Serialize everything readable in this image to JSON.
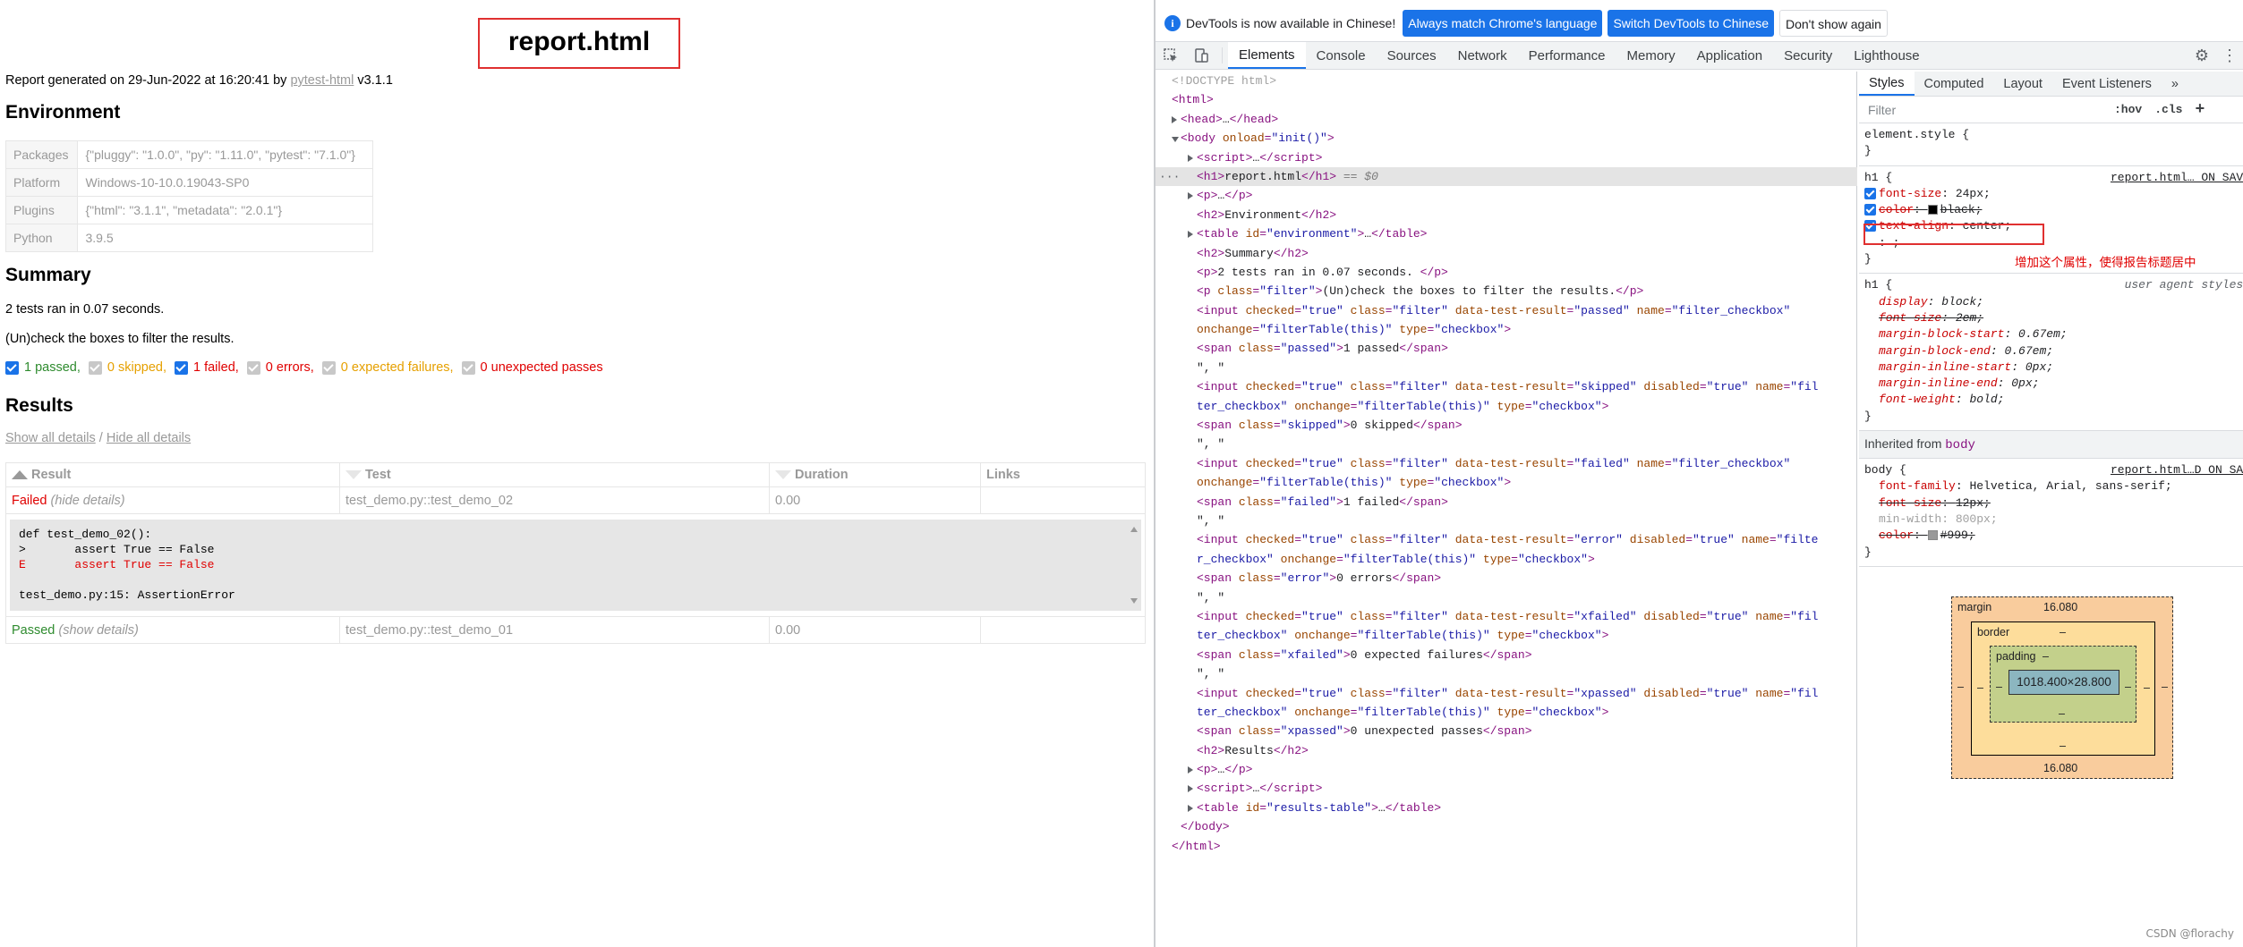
{
  "report": {
    "title": "report.html",
    "generated_prefix": "Report generated on 29-Jun-2022 at 16:20:41 by ",
    "generated_link": "pytest-html",
    "generated_suffix": " v3.1.1",
    "env_heading": "Environment",
    "environment": [
      {
        "key": "Packages",
        "value": "{\"pluggy\": \"1.0.0\", \"py\": \"1.11.0\", \"pytest\": \"7.1.0\"}"
      },
      {
        "key": "Platform",
        "value": "Windows-10-10.0.19043-SP0"
      },
      {
        "key": "Plugins",
        "value": "{\"html\": \"3.1.1\", \"metadata\": \"2.0.1\"}"
      },
      {
        "key": "Python",
        "value": "3.9.5"
      }
    ],
    "summary_heading": "Summary",
    "summary_text": "2 tests ran in 0.07 seconds.",
    "filter_hint": "(Un)check the boxes to filter the results.",
    "filters": [
      {
        "label": "1 passed",
        "checked": true,
        "disabled": false
      },
      {
        "label": "0 skipped",
        "checked": true,
        "disabled": true
      },
      {
        "label": "1 failed",
        "checked": true,
        "disabled": false
      },
      {
        "label": "0 errors",
        "checked": true,
        "disabled": true
      },
      {
        "label": "0 expected failures",
        "checked": true,
        "disabled": true
      },
      {
        "label": "0 unexpected passes",
        "checked": true,
        "disabled": true
      }
    ],
    "results_heading": "Results",
    "show_all": "Show all details",
    "hide_all": "Hide all details",
    "slash": " / ",
    "columns": [
      "Result",
      "Test",
      "Duration",
      "Links"
    ],
    "rows": [
      {
        "result": "Failed",
        "toggle": "(hide details)",
        "test": "test_demo.py::test_demo_02",
        "duration": "0.00",
        "links": ""
      },
      {
        "result": "Passed",
        "toggle": "(show details)",
        "test": "test_demo.py::test_demo_01",
        "duration": "0.00",
        "links": ""
      }
    ],
    "log_lines": [
      "def test_demo_02():",
      ">       assert True == False",
      "E       assert True == False",
      "",
      "test_demo.py:15: AssertionError"
    ]
  },
  "devtools": {
    "info_text": "DevTools is now available in Chinese!",
    "btn_match": "Always match Chrome's language",
    "btn_switch": "Switch DevTools to Chinese",
    "btn_dont": "Don't show again",
    "tabs": [
      "Elements",
      "Console",
      "Sources",
      "Network",
      "Performance",
      "Memory",
      "Application",
      "Security",
      "Lighthouse"
    ],
    "style_tabs": [
      "Styles",
      "Computed",
      "Layout",
      "Event Listeners"
    ],
    "more_tabs": "»",
    "filter_placeholder": "Filter",
    "hov": ":hov",
    "cls": ".cls",
    "plus": "+",
    "element_style": "element.style {",
    "close_brace": "}",
    "h1_rule": {
      "selector": "h1 {",
      "source": "report.html…_ON_SAVE",
      "props": [
        {
          "name": "font-size",
          "value": "24px;"
        },
        {
          "name": "color",
          "value": "black;"
        },
        {
          "name": "text-align",
          "value": "center;"
        }
      ],
      "partial": ": ;"
    },
    "annotation": "增加这个属性，使得报告标题居中",
    "ua_rule": {
      "selector": "h1 {",
      "source": "user agent stylesh",
      "props": [
        {
          "name": "display",
          "value": "block;",
          "struck": false
        },
        {
          "name": "font-size",
          "value": "2em;",
          "struck": true
        },
        {
          "name": "margin-block-start",
          "value": "0.67em;",
          "struck": false
        },
        {
          "name": "margin-block-end",
          "value": "0.67em;",
          "struck": false
        },
        {
          "name": "margin-inline-start",
          "value": "0px;",
          "struck": false
        },
        {
          "name": "margin-inline-end",
          "value": "0px;",
          "struck": false
        },
        {
          "name": "font-weight",
          "value": "bold;",
          "struck": false
        }
      ]
    },
    "inherited_label": "Inherited from ",
    "inherited_tag": "body",
    "body_rule": {
      "selector": "body {",
      "source": "report.html…D_ON_SAV",
      "props": [
        {
          "name": "font-family",
          "value": "Helvetica, Arial, sans-serif;",
          "struck": false,
          "dim": false
        },
        {
          "name": "font-size",
          "value": "12px;",
          "struck": true,
          "dim": false
        },
        {
          "name": "min-width",
          "value": "800px;",
          "struck": false,
          "dim": true
        },
        {
          "name": "color",
          "value": "#999;",
          "struck": true,
          "dim": false
        }
      ]
    },
    "box_model": {
      "margin_label": "margin",
      "margin_top": "16.080",
      "margin_bottom": "16.080",
      "border_label": "border",
      "border_val": "–",
      "padding_label": "padding",
      "padding_val": "–",
      "content": "1018.400×28.800",
      "dash": "–"
    },
    "dom_lines": [
      {
        "indent": 0,
        "tw": "",
        "html": "<span class='cm'>&lt;!DOCTYPE html&gt;</span>"
      },
      {
        "indent": 0,
        "tw": "",
        "html": "<span class='tag'>&lt;html&gt;</span>"
      },
      {
        "indent": 1,
        "tw": "c",
        "html": "<span class='tag'>&lt;head&gt;</span><span class='tx'>…</span><span class='tag'>&lt;/head&gt;</span>"
      },
      {
        "indent": 1,
        "tw": "o",
        "html": "<span class='tag'>&lt;body </span><span class='an'>onload</span><span class='tag'>=</span><span class='av'>\"init()\"</span><span class='tag'>&gt;</span>"
      },
      {
        "indent": 2,
        "tw": "c",
        "html": "<span class='tag'>&lt;script&gt;</span><span class='tx'>…</span><span class='tag'>&lt;/script&gt;</span>"
      },
      {
        "indent": 2,
        "tw": "",
        "sel": true,
        "html": "<span class='tag'>&lt;h1&gt;</span><span class='tx'>report.html</span><span class='tag'>&lt;/h1&gt;</span> <span class='eq0'>== $0</span>"
      },
      {
        "indent": 2,
        "tw": "c",
        "html": "<span class='tag'>&lt;p&gt;</span><span class='tx'>…</span><span class='tag'>&lt;/p&gt;</span>"
      },
      {
        "indent": 2,
        "tw": "",
        "html": "<span class='tag'>&lt;h2&gt;</span><span class='tx'>Environment</span><span class='tag'>&lt;/h2&gt;</span>"
      },
      {
        "indent": 2,
        "tw": "c",
        "html": "<span class='tag'>&lt;table </span><span class='an'>id</span><span class='tag'>=</span><span class='av'>\"environment\"</span><span class='tag'>&gt;</span><span class='tx'>…</span><span class='tag'>&lt;/table&gt;</span>"
      },
      {
        "indent": 2,
        "tw": "",
        "html": "<span class='tag'>&lt;h2&gt;</span><span class='tx'>Summary</span><span class='tag'>&lt;/h2&gt;</span>"
      },
      {
        "indent": 2,
        "tw": "",
        "html": "<span class='tag'>&lt;p&gt;</span><span class='tx'>2 tests ran in 0.07 seconds. </span><span class='tag'>&lt;/p&gt;</span>"
      },
      {
        "indent": 2,
        "tw": "",
        "html": "<span class='tag'>&lt;p </span><span class='an'>class</span><span class='tag'>=</span><span class='av'>\"filter\"</span><span class='tag'>&gt;</span><span class='tx'>(Un)check the boxes to filter the results.</span><span class='tag'>&lt;/p&gt;</span>"
      },
      {
        "indent": 2,
        "tw": "",
        "html": "<span class='tag'>&lt;input </span><span class='an'>checked</span><span class='tag'>=</span><span class='av'>\"true\"</span> <span class='an'>class</span><span class='tag'>=</span><span class='av'>\"filter\"</span> <span class='an'>data-test-result</span><span class='tag'>=</span><span class='av'>\"passed\"</span> <span class='an'>name</span><span class='tag'>=</span><span class='av'>\"filter_checkbox\"</span>"
      },
      {
        "indent": 2,
        "tw": "",
        "html": "<span class='an'>onchange</span><span class='tag'>=</span><span class='av'>\"filterTable(this)\"</span> <span class='an'>type</span><span class='tag'>=</span><span class='av'>\"checkbox\"</span><span class='tag'>&gt;</span>"
      },
      {
        "indent": 2,
        "tw": "",
        "html": "<span class='tag'>&lt;span </span><span class='an'>class</span><span class='tag'>=</span><span class='av'>\"passed\"</span><span class='tag'>&gt;</span><span class='tx'>1 passed</span><span class='tag'>&lt;/span&gt;</span>"
      },
      {
        "indent": 2,
        "tw": "",
        "html": "<span class='tx'>\", \"</span>"
      },
      {
        "indent": 2,
        "tw": "",
        "html": "<span class='tag'>&lt;input </span><span class='an'>checked</span><span class='tag'>=</span><span class='av'>\"true\"</span> <span class='an'>class</span><span class='tag'>=</span><span class='av'>\"filter\"</span> <span class='an'>data-test-result</span><span class='tag'>=</span><span class='av'>\"skipped\"</span> <span class='an'>disabled</span><span class='tag'>=</span><span class='av'>\"true\"</span> <span class='an'>name</span><span class='tag'>=</span><span class='av'>\"fil</span>"
      },
      {
        "indent": 2,
        "tw": "",
        "html": "<span class='av'>ter_checkbox\"</span> <span class='an'>onchange</span><span class='tag'>=</span><span class='av'>\"filterTable(this)\"</span> <span class='an'>type</span><span class='tag'>=</span><span class='av'>\"checkbox\"</span><span class='tag'>&gt;</span>"
      },
      {
        "indent": 2,
        "tw": "",
        "html": "<span class='tag'>&lt;span </span><span class='an'>class</span><span class='tag'>=</span><span class='av'>\"skipped\"</span><span class='tag'>&gt;</span><span class='tx'>0 skipped</span><span class='tag'>&lt;/span&gt;</span>"
      },
      {
        "indent": 2,
        "tw": "",
        "html": "<span class='tx'>\", \"</span>"
      },
      {
        "indent": 2,
        "tw": "",
        "html": "<span class='tag'>&lt;input </span><span class='an'>checked</span><span class='tag'>=</span><span class='av'>\"true\"</span> <span class='an'>class</span><span class='tag'>=</span><span class='av'>\"filter\"</span> <span class='an'>data-test-result</span><span class='tag'>=</span><span class='av'>\"failed\"</span> <span class='an'>name</span><span class='tag'>=</span><span class='av'>\"filter_checkbox\"</span>"
      },
      {
        "indent": 2,
        "tw": "",
        "html": "<span class='an'>onchange</span><span class='tag'>=</span><span class='av'>\"filterTable(this)\"</span> <span class='an'>type</span><span class='tag'>=</span><span class='av'>\"checkbox\"</span><span class='tag'>&gt;</span>"
      },
      {
        "indent": 2,
        "tw": "",
        "html": "<span class='tag'>&lt;span </span><span class='an'>class</span><span class='tag'>=</span><span class='av'>\"failed\"</span><span class='tag'>&gt;</span><span class='tx'>1 failed</span><span class='tag'>&lt;/span&gt;</span>"
      },
      {
        "indent": 2,
        "tw": "",
        "html": "<span class='tx'>\", \"</span>"
      },
      {
        "indent": 2,
        "tw": "",
        "html": "<span class='tag'>&lt;input </span><span class='an'>checked</span><span class='tag'>=</span><span class='av'>\"true\"</span> <span class='an'>class</span><span class='tag'>=</span><span class='av'>\"filter\"</span> <span class='an'>data-test-result</span><span class='tag'>=</span><span class='av'>\"error\"</span> <span class='an'>disabled</span><span class='tag'>=</span><span class='av'>\"true\"</span> <span class='an'>name</span><span class='tag'>=</span><span class='av'>\"filte</span>"
      },
      {
        "indent": 2,
        "tw": "",
        "html": "<span class='av'>r_checkbox\"</span> <span class='an'>onchange</span><span class='tag'>=</span><span class='av'>\"filterTable(this)\"</span> <span class='an'>type</span><span class='tag'>=</span><span class='av'>\"checkbox\"</span><span class='tag'>&gt;</span>"
      },
      {
        "indent": 2,
        "tw": "",
        "html": "<span class='tag'>&lt;span </span><span class='an'>class</span><span class='tag'>=</span><span class='av'>\"error\"</span><span class='tag'>&gt;</span><span class='tx'>0 errors</span><span class='tag'>&lt;/span&gt;</span>"
      },
      {
        "indent": 2,
        "tw": "",
        "html": "<span class='tx'>\", \"</span>"
      },
      {
        "indent": 2,
        "tw": "",
        "html": "<span class='tag'>&lt;input </span><span class='an'>checked</span><span class='tag'>=</span><span class='av'>\"true\"</span> <span class='an'>class</span><span class='tag'>=</span><span class='av'>\"filter\"</span> <span class='an'>data-test-result</span><span class='tag'>=</span><span class='av'>\"xfailed\"</span> <span class='an'>disabled</span><span class='tag'>=</span><span class='av'>\"true\"</span> <span class='an'>name</span><span class='tag'>=</span><span class='av'>\"fil</span>"
      },
      {
        "indent": 2,
        "tw": "",
        "html": "<span class='av'>ter_checkbox\"</span> <span class='an'>onchange</span><span class='tag'>=</span><span class='av'>\"filterTable(this)\"</span> <span class='an'>type</span><span class='tag'>=</span><span class='av'>\"checkbox\"</span><span class='tag'>&gt;</span>"
      },
      {
        "indent": 2,
        "tw": "",
        "html": "<span class='tag'>&lt;span </span><span class='an'>class</span><span class='tag'>=</span><span class='av'>\"xfailed\"</span><span class='tag'>&gt;</span><span class='tx'>0 expected failures</span><span class='tag'>&lt;/span&gt;</span>"
      },
      {
        "indent": 2,
        "tw": "",
        "html": "<span class='tx'>\", \"</span>"
      },
      {
        "indent": 2,
        "tw": "",
        "html": "<span class='tag'>&lt;input </span><span class='an'>checked</span><span class='tag'>=</span><span class='av'>\"true\"</span> <span class='an'>class</span><span class='tag'>=</span><span class='av'>\"filter\"</span> <span class='an'>data-test-result</span><span class='tag'>=</span><span class='av'>\"xpassed\"</span> <span class='an'>disabled</span><span class='tag'>=</span><span class='av'>\"true\"</span> <span class='an'>name</span><span class='tag'>=</span><span class='av'>\"fil</span>"
      },
      {
        "indent": 2,
        "tw": "",
        "html": "<span class='av'>ter_checkbox\"</span> <span class='an'>onchange</span><span class='tag'>=</span><span class='av'>\"filterTable(this)\"</span> <span class='an'>type</span><span class='tag'>=</span><span class='av'>\"checkbox\"</span><span class='tag'>&gt;</span>"
      },
      {
        "indent": 2,
        "tw": "",
        "html": "<span class='tag'>&lt;span </span><span class='an'>class</span><span class='tag'>=</span><span class='av'>\"xpassed\"</span><span class='tag'>&gt;</span><span class='tx'>0 unexpected passes</span><span class='tag'>&lt;/span&gt;</span>"
      },
      {
        "indent": 2,
        "tw": "",
        "html": "<span class='tag'>&lt;h2&gt;</span><span class='tx'>Results</span><span class='tag'>&lt;/h2&gt;</span>"
      },
      {
        "indent": 2,
        "tw": "c",
        "html": "<span class='tag'>&lt;p&gt;</span><span class='tx'>…</span><span class='tag'>&lt;/p&gt;</span>"
      },
      {
        "indent": 2,
        "tw": "c",
        "html": "<span class='tag'>&lt;script&gt;</span><span class='tx'>…</span><span class='tag'>&lt;/script&gt;</span>"
      },
      {
        "indent": 2,
        "tw": "c",
        "html": "<span class='tag'>&lt;table </span><span class='an'>id</span><span class='tag'>=</span><span class='av'>\"results-table\"</span><span class='tag'>&gt;</span><span class='tx'>…</span><span class='tag'>&lt;/table&gt;</span>"
      },
      {
        "indent": 1,
        "tw": "",
        "html": "<span class='tag'>&lt;/body&gt;</span>"
      },
      {
        "indent": 0,
        "tw": "",
        "html": "<span class='tag'>&lt;/html&gt;</span>"
      }
    ]
  },
  "watermark": "CSDN @florachy",
  "colors": {
    "accent": "#1a73e8",
    "failed": "#e00000",
    "passed": "#2e8b2e",
    "skipped": "#e6a000",
    "highlight": "#e03030"
  }
}
